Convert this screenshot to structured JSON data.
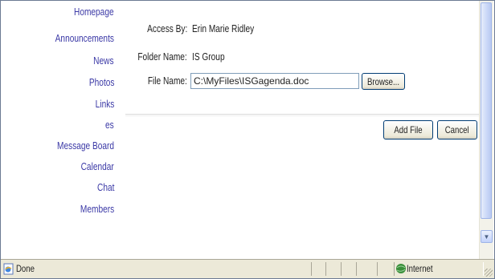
{
  "nav": {
    "items": [
      {
        "label": "Homepage"
      },
      {
        "label": "Announcements"
      },
      {
        "label": "News"
      },
      {
        "label": "Photos"
      },
      {
        "label": "Links"
      },
      {
        "label": "es"
      },
      {
        "label": "Message Board"
      },
      {
        "label": "Calendar"
      },
      {
        "label": "Chat"
      },
      {
        "label": "Members"
      }
    ]
  },
  "form": {
    "access_label": "Access By:",
    "access_value": "Erin Marie Ridley",
    "folder_label": "Folder Name:",
    "folder_value": "IS Group",
    "file_label": "File Name:",
    "file_value": "C:\\MyFiles\\ISGagenda.doc",
    "browse_label": "Browse..."
  },
  "actions": {
    "add_label": "Add File",
    "cancel_label": "Cancel"
  },
  "status": {
    "text": "Done",
    "zone": "Internet"
  },
  "icons": {
    "page": "ie-page-icon",
    "zone": "globe-icon",
    "scroll": "scroll-down-arrow-icon"
  }
}
